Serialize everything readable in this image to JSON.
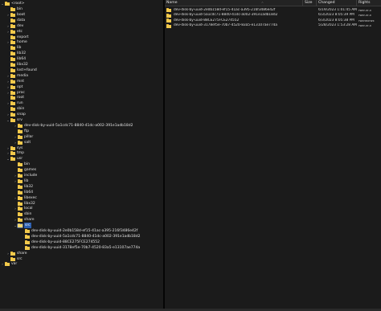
{
  "tree": {
    "root_label": "<root>",
    "items": [
      {
        "label": "bin",
        "depth": 1,
        "expander": ""
      },
      {
        "label": "boot",
        "depth": 1,
        "expander": "›"
      },
      {
        "label": "data",
        "depth": 1,
        "expander": ""
      },
      {
        "label": "dev",
        "depth": 1,
        "expander": "›"
      },
      {
        "label": "etc",
        "depth": 1,
        "expander": "›"
      },
      {
        "label": "export",
        "depth": 1,
        "expander": ""
      },
      {
        "label": "home",
        "depth": 1,
        "expander": "›"
      },
      {
        "label": "lib",
        "depth": 1,
        "expander": ""
      },
      {
        "label": "lib32",
        "depth": 1,
        "expander": ""
      },
      {
        "label": "lib64",
        "depth": 1,
        "expander": ""
      },
      {
        "label": "libx32",
        "depth": 1,
        "expander": ""
      },
      {
        "label": "lost+found",
        "depth": 1,
        "expander": ""
      },
      {
        "label": "media",
        "depth": 1,
        "expander": "›"
      },
      {
        "label": "mnt",
        "depth": 1,
        "expander": "›"
      },
      {
        "label": "opt",
        "depth": 1,
        "expander": "›"
      },
      {
        "label": "proc",
        "depth": 1,
        "expander": "›"
      },
      {
        "label": "root",
        "depth": 1,
        "expander": ""
      },
      {
        "label": "run",
        "depth": 1,
        "expander": "›"
      },
      {
        "label": "sbin",
        "depth": 1,
        "expander": ""
      },
      {
        "label": "snap",
        "depth": 1,
        "expander": "›"
      },
      {
        "label": "srv",
        "depth": 1,
        "expander": "⌄"
      },
      {
        "label": "dev-disk-by-uuid-5a1cdc71-8840-41dc-a002-391e1adb18d2",
        "depth": 2,
        "expander": "›"
      },
      {
        "label": "ftp",
        "depth": 2,
        "expander": ""
      },
      {
        "label": "pillar",
        "depth": 2,
        "expander": "›"
      },
      {
        "label": "salt",
        "depth": 2,
        "expander": "›"
      },
      {
        "label": "sys",
        "depth": 1,
        "expander": "›"
      },
      {
        "label": "tmp",
        "depth": 1,
        "expander": "›"
      },
      {
        "label": "usr",
        "depth": 1,
        "expander": "⌄"
      },
      {
        "label": "bin",
        "depth": 2,
        "expander": ""
      },
      {
        "label": "games",
        "depth": 2,
        "expander": ""
      },
      {
        "label": "include",
        "depth": 2,
        "expander": "›"
      },
      {
        "label": "lib",
        "depth": 2,
        "expander": "›"
      },
      {
        "label": "lib32",
        "depth": 2,
        "expander": ""
      },
      {
        "label": "lib64",
        "depth": 2,
        "expander": ""
      },
      {
        "label": "libexec",
        "depth": 2,
        "expander": "›"
      },
      {
        "label": "libx32",
        "depth": 2,
        "expander": ""
      },
      {
        "label": "local",
        "depth": 2,
        "expander": "›"
      },
      {
        "label": "sbin",
        "depth": 2,
        "expander": ""
      },
      {
        "label": "share",
        "depth": 2,
        "expander": "›"
      },
      {
        "label": "src",
        "depth": 2,
        "expander": "⌄",
        "selected": true
      },
      {
        "label": "dev-disk-by-uuid-2e0b158d-ef15-41ac-a395-216f3486e42f",
        "depth": 3,
        "expander": ""
      },
      {
        "label": "dev-disk-by-uuid-5a1cdc71-8840-41dc-a002-391e1adb18d2",
        "depth": 3,
        "expander": ""
      },
      {
        "label": "dev-disk-by-uuid-88CE275FCE274552",
        "depth": 3,
        "expander": ""
      },
      {
        "label": "dev-disk-by-uuid-3178ef5e-70b7-4520-83a5-e13107ae774a",
        "depth": 3,
        "expander": ""
      },
      {
        "label": "share",
        "depth": 1,
        "expander": "›"
      },
      {
        "label": "src",
        "depth": 1,
        "expander": ""
      },
      {
        "label": "var",
        "depth": 0,
        "expander": "›"
      }
    ]
  },
  "list": {
    "columns": {
      "name": "Name",
      "size": "Size",
      "changed": "Changed",
      "rights": "Rights"
    },
    "rows": [
      {
        "name": "dev-disk-by-uuid-2e0b158d-ef15-41ac-a395-216f3486e42f",
        "size": "",
        "changed": "6/19/2023 1:01:45 AM",
        "rights": "rwxr-xr-x"
      },
      {
        "name": "dev-disk-by-uuid-5a1cdc71-8840-41dc-a002-391e1adb18d2",
        "size": "",
        "changed": "6/3/2023 8:05:39 PM",
        "rights": "rwxr-xr-x"
      },
      {
        "name": "dev-disk-by-uuid-88CE275FCE274552",
        "size": "",
        "changed": "6/3/2023 8:05:38 PM",
        "rights": "rwxrwxrwx"
      },
      {
        "name": "dev-disk-by-uuid-3178ef5e-70b7-4520-83a5-e13107ae774a",
        "size": "",
        "changed": "5/28/2023 1:53:28 AM",
        "rights": "rwxr-xr-x"
      }
    ]
  },
  "colors": {
    "folder": "#f2c94c",
    "background": "#1b1b1b",
    "selection": "#2c5fb0"
  }
}
